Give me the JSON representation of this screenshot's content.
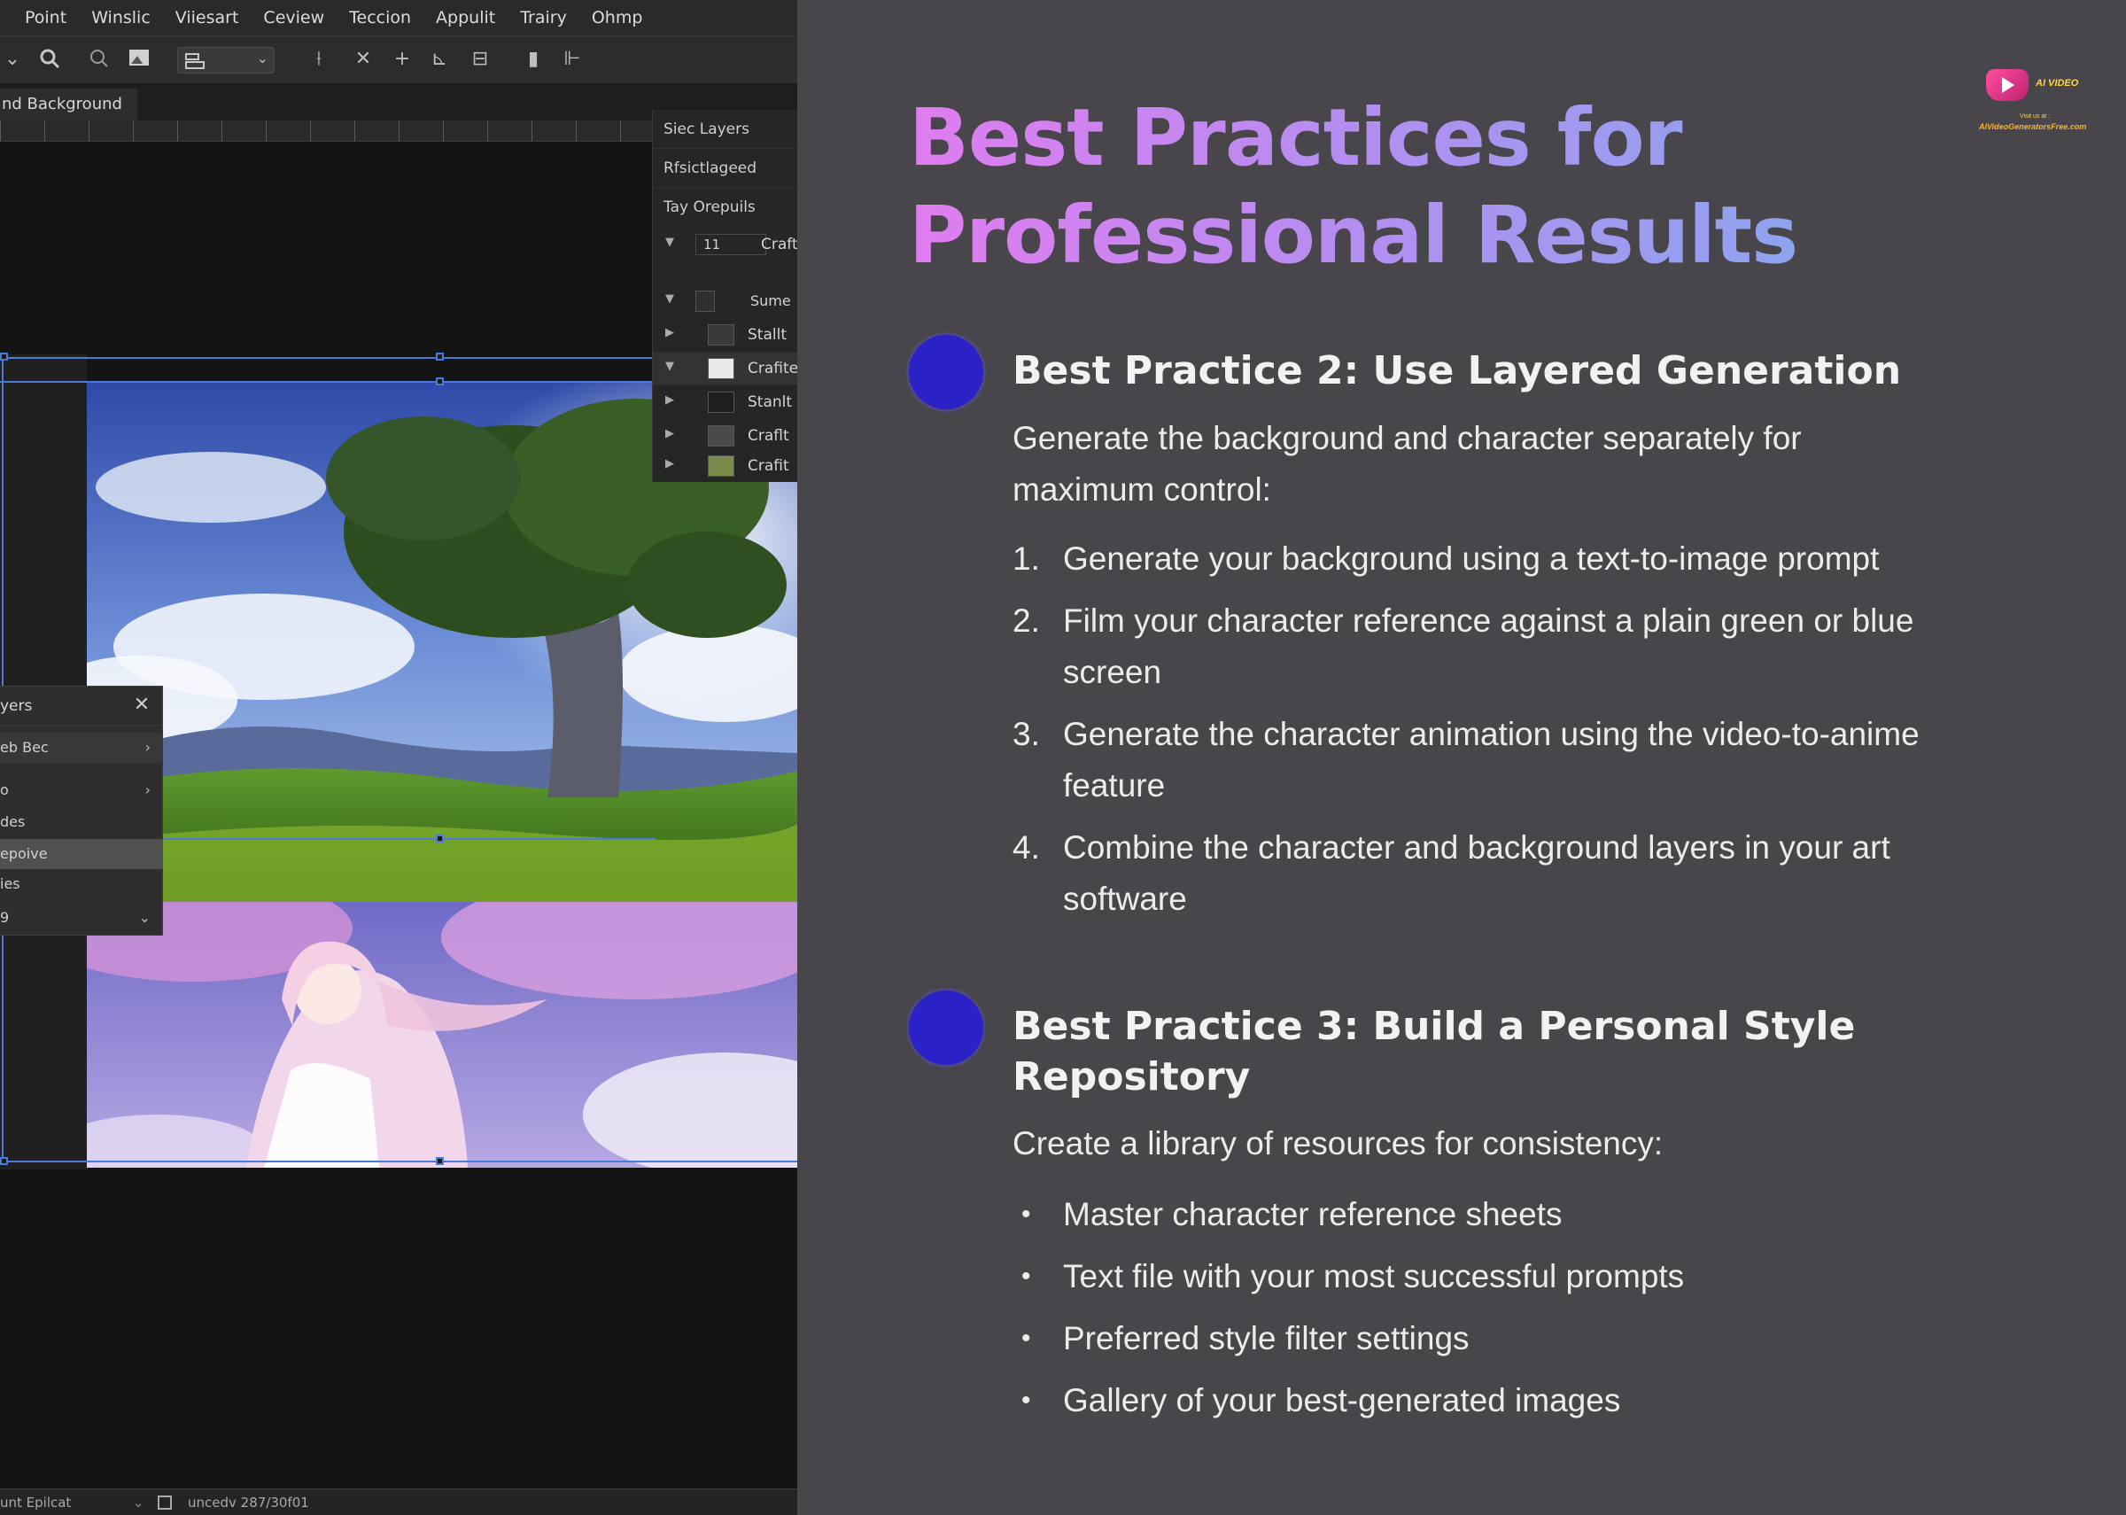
{
  "editor": {
    "menu": [
      "Point",
      "Winslic",
      "Viiesart",
      "Ceview",
      "Teccion",
      "Appulit",
      "Trairy",
      "Ohmp"
    ],
    "document_tab": "nd Background",
    "layers_panel": {
      "header_1": "Siec Layers",
      "header_2": "Rfsictlageed",
      "header_3": "Tay Orepuils",
      "opacity_value": "11",
      "opacity_label": "Craft",
      "group_name": "Sume",
      "rows": [
        "Stallt",
        "Crafites",
        "Stanlt",
        "Craflt",
        "Crafit"
      ]
    },
    "float_panel": {
      "title": "yers",
      "close_symbol": "✕",
      "rows": [
        {
          "label": "eb Bec",
          "trail": "›"
        },
        {
          "label": "o",
          "trail": "›"
        },
        {
          "label": "des",
          "trail": ""
        },
        {
          "label": "epoive",
          "trail": ""
        },
        {
          "label": "ies",
          "trail": ""
        },
        {
          "label": "9",
          "trail": "⌄"
        }
      ]
    },
    "status_left": "unt Epilcat",
    "status_right": "uncedv 287/30f01"
  },
  "slide": {
    "title": "Best Practices for Professional Results",
    "logo": {
      "brand": "AI VIDEO",
      "visit": "Visit us at :",
      "site": "AIVideoGeneratorsFree.com"
    },
    "section1": {
      "heading": "Best Practice 2: Use Layered Generation",
      "intro": "Generate the background and character separately for maximum control:",
      "steps": [
        {
          "num": "1.",
          "text": "Generate your background using a text-to-image prompt"
        },
        {
          "num": "2.",
          "text": "Film your character reference against a plain green or blue screen"
        },
        {
          "num": "3.",
          "text": "Generate the character animation using the video-to-anime feature"
        },
        {
          "num": "4.",
          "text": "Combine the character and background layers in your art software"
        }
      ]
    },
    "section2": {
      "heading": "Best Practice 3: Build a Personal Style Repository",
      "intro": "Create a library of resources for consistency:",
      "bullet_symbol": "•",
      "items": [
        "Master character reference sheets",
        "Text file with your most successful prompts",
        "Preferred style filter settings",
        "Gallery of your best-generated images"
      ]
    },
    "colors": {
      "background": "#48464a",
      "title_gradient_start": "#e07df0",
      "title_gradient_end": "#86a8ee",
      "bullet_dot": "#2a21c6"
    }
  }
}
